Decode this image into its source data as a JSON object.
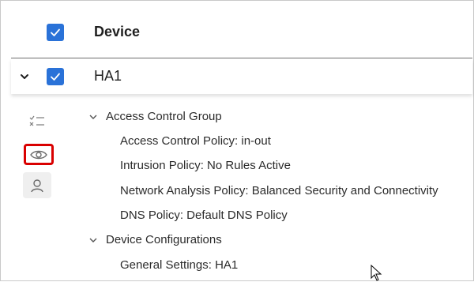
{
  "table": {
    "header": {
      "column_title": "Device",
      "select_all_checked": true
    },
    "device": {
      "name": "HA1",
      "checked": true,
      "expanded": true
    }
  },
  "side_icons": [
    "checklist-icon",
    "eye-icon",
    "user-icon"
  ],
  "tree": {
    "groups": [
      {
        "label": "Access Control Group",
        "items": [
          "Access Control Policy: in-out",
          "Intrusion Policy: No Rules Active",
          "Network Analysis Policy: Balanced Security and Connectivity",
          "DNS Policy: Default DNS Policy"
        ]
      },
      {
        "label": "Device Configurations",
        "items": [
          "General Settings: HA1"
        ]
      }
    ]
  },
  "colors": {
    "checkbox": "#2a72d8",
    "highlight": "#d90000"
  }
}
